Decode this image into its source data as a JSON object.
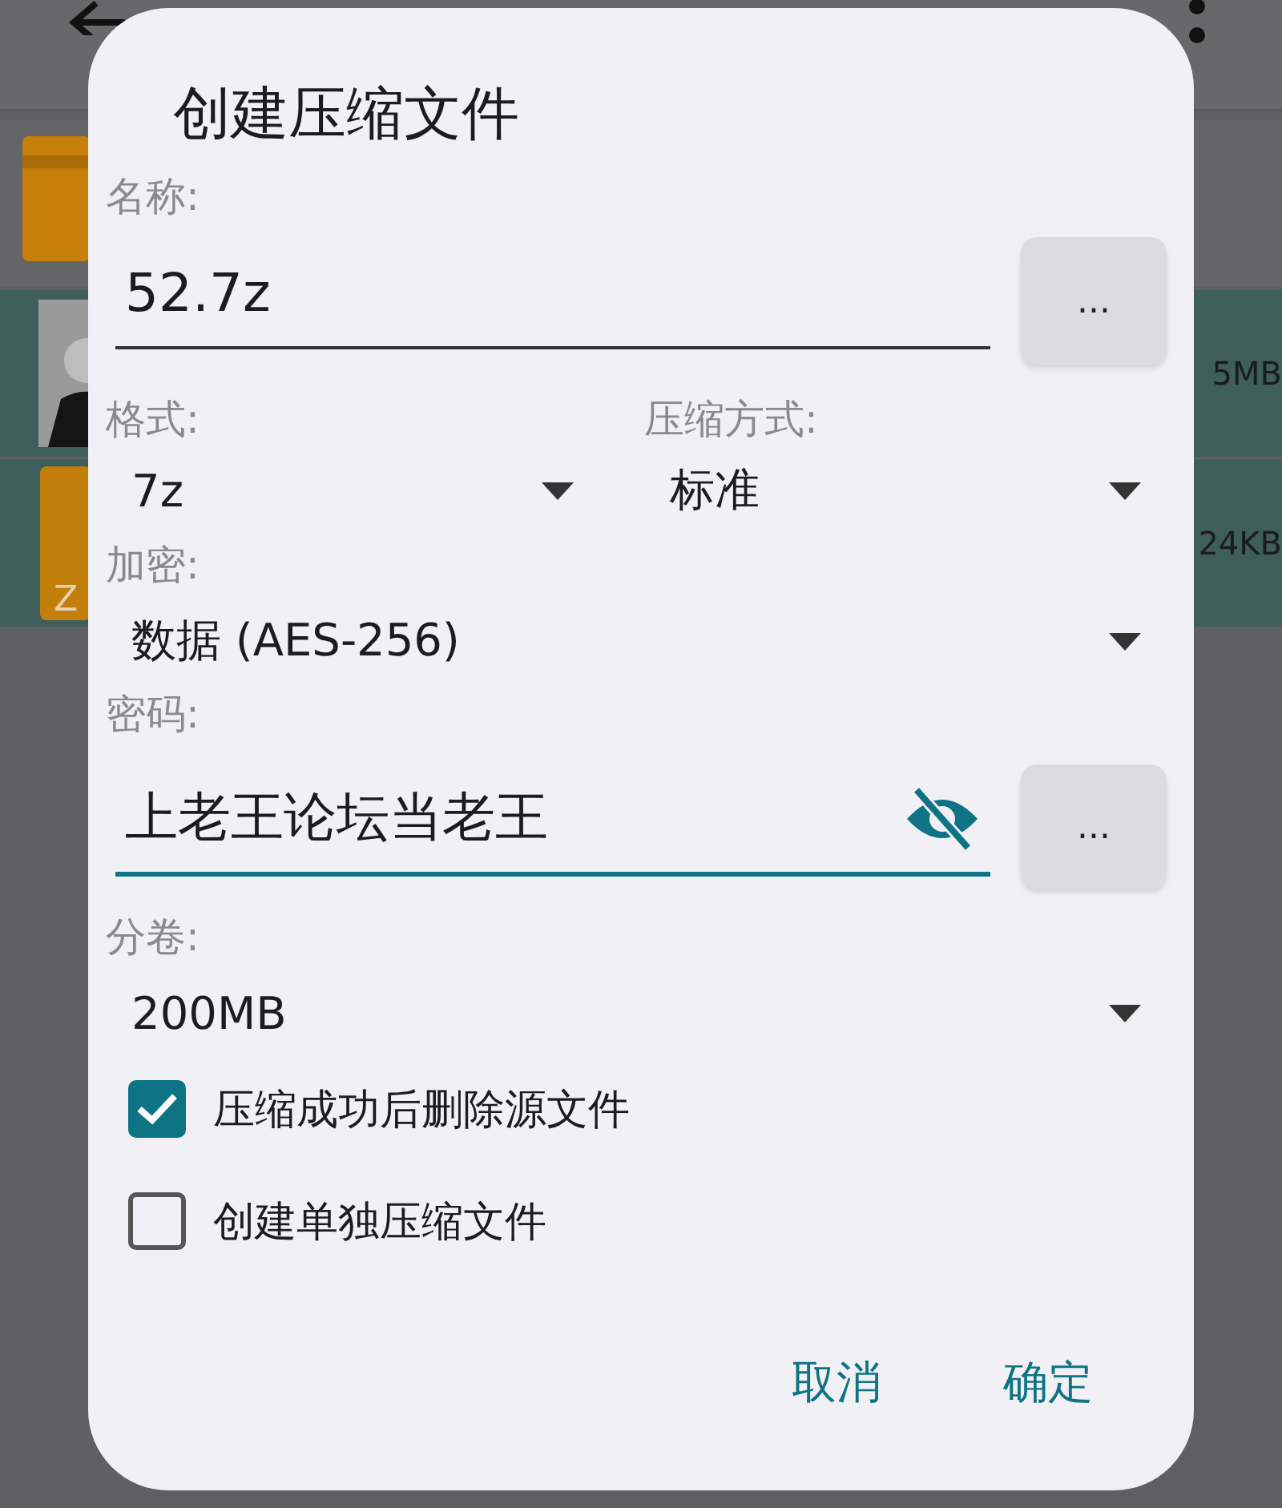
{
  "background": {
    "rows": [
      {
        "kind": "folder",
        "selected": false
      },
      {
        "kind": "picture",
        "selected": true,
        "size": "5MB"
      },
      {
        "kind": "archive",
        "selected": true,
        "size": "24KB",
        "badge": "Z"
      }
    ]
  },
  "dialog": {
    "title": "创建压缩文件",
    "name": {
      "label": "名称:",
      "value": "52.7z",
      "focused": false,
      "button": "..."
    },
    "format": {
      "label": "格式:",
      "value": "7z"
    },
    "method": {
      "label": "压缩方式:",
      "value": "标准"
    },
    "encryption": {
      "label": "加密:",
      "value": "数据 (AES-256)"
    },
    "password": {
      "label": "密码:",
      "value": "上老王论坛当老王",
      "focused": true,
      "visible": true,
      "button": "..."
    },
    "split": {
      "label": "分卷:",
      "value": "200MB"
    },
    "options": [
      {
        "label": "压缩成功后删除源文件",
        "checked": true
      },
      {
        "label": "创建单独压缩文件",
        "checked": false
      }
    ],
    "buttons": [
      "取消",
      "确定"
    ]
  }
}
